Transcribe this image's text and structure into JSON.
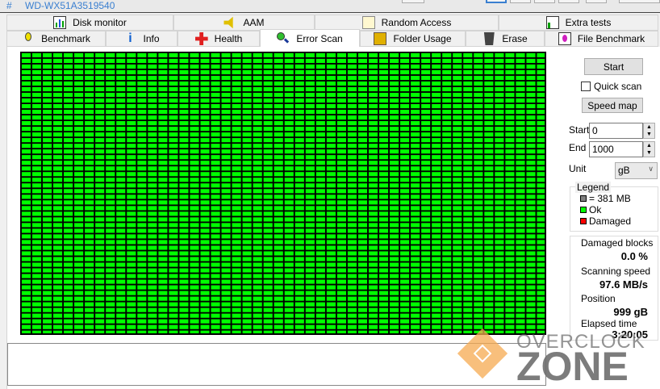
{
  "title": {
    "hash": "#",
    "drive": "WD-WX51A3519540"
  },
  "tabs_row1": [
    {
      "label": "Disk monitor",
      "icon": "disk-monitor-icon"
    },
    {
      "label": "AAM",
      "icon": "speaker-icon"
    },
    {
      "label": "Random Access",
      "icon": "random-access-icon"
    },
    {
      "label": "Extra tests",
      "icon": "extra-tests-icon"
    }
  ],
  "tabs_row2": [
    {
      "label": "Benchmark",
      "icon": "lightbulb-icon"
    },
    {
      "label": "Info",
      "icon": "info-icon"
    },
    {
      "label": "Health",
      "icon": "red-cross-icon"
    },
    {
      "label": "Error Scan",
      "icon": "magnifier-icon",
      "selected": true
    },
    {
      "label": "Folder Usage",
      "icon": "folder-icon"
    },
    {
      "label": "Erase",
      "icon": "trash-icon"
    },
    {
      "label": "File Benchmark",
      "icon": "file-benchmark-icon"
    }
  ],
  "scan_map": {
    "columns": 50,
    "rows": 50,
    "status": "Ok"
  },
  "controls": {
    "start_button": "Start",
    "quick_scan": "Quick scan",
    "quick_scan_checked": false,
    "speed_map_button": "Speed map",
    "start_label": "Start",
    "start_value": "0",
    "end_label": "End",
    "end_value": "1000",
    "unit_label": "Unit",
    "unit_value": "gB"
  },
  "legend": {
    "title": "Legend",
    "block": "= 381 MB",
    "ok": "Ok",
    "damaged": "Damaged"
  },
  "colors": {
    "block": "#808080",
    "ok": "#00ff00",
    "damaged": "#ff0000"
  },
  "stats": {
    "damaged_label": "Damaged blocks",
    "damaged_value": "0.0 %",
    "speed_label": "Scanning speed",
    "speed_value": "97.6 MB/s",
    "position_label": "Position",
    "position_value": "999 gB",
    "elapsed_label": "Elapsed time",
    "elapsed_value": "3:20:05"
  },
  "watermark": {
    "line1": "OVERCLOCK",
    "line2": "ZONE"
  }
}
